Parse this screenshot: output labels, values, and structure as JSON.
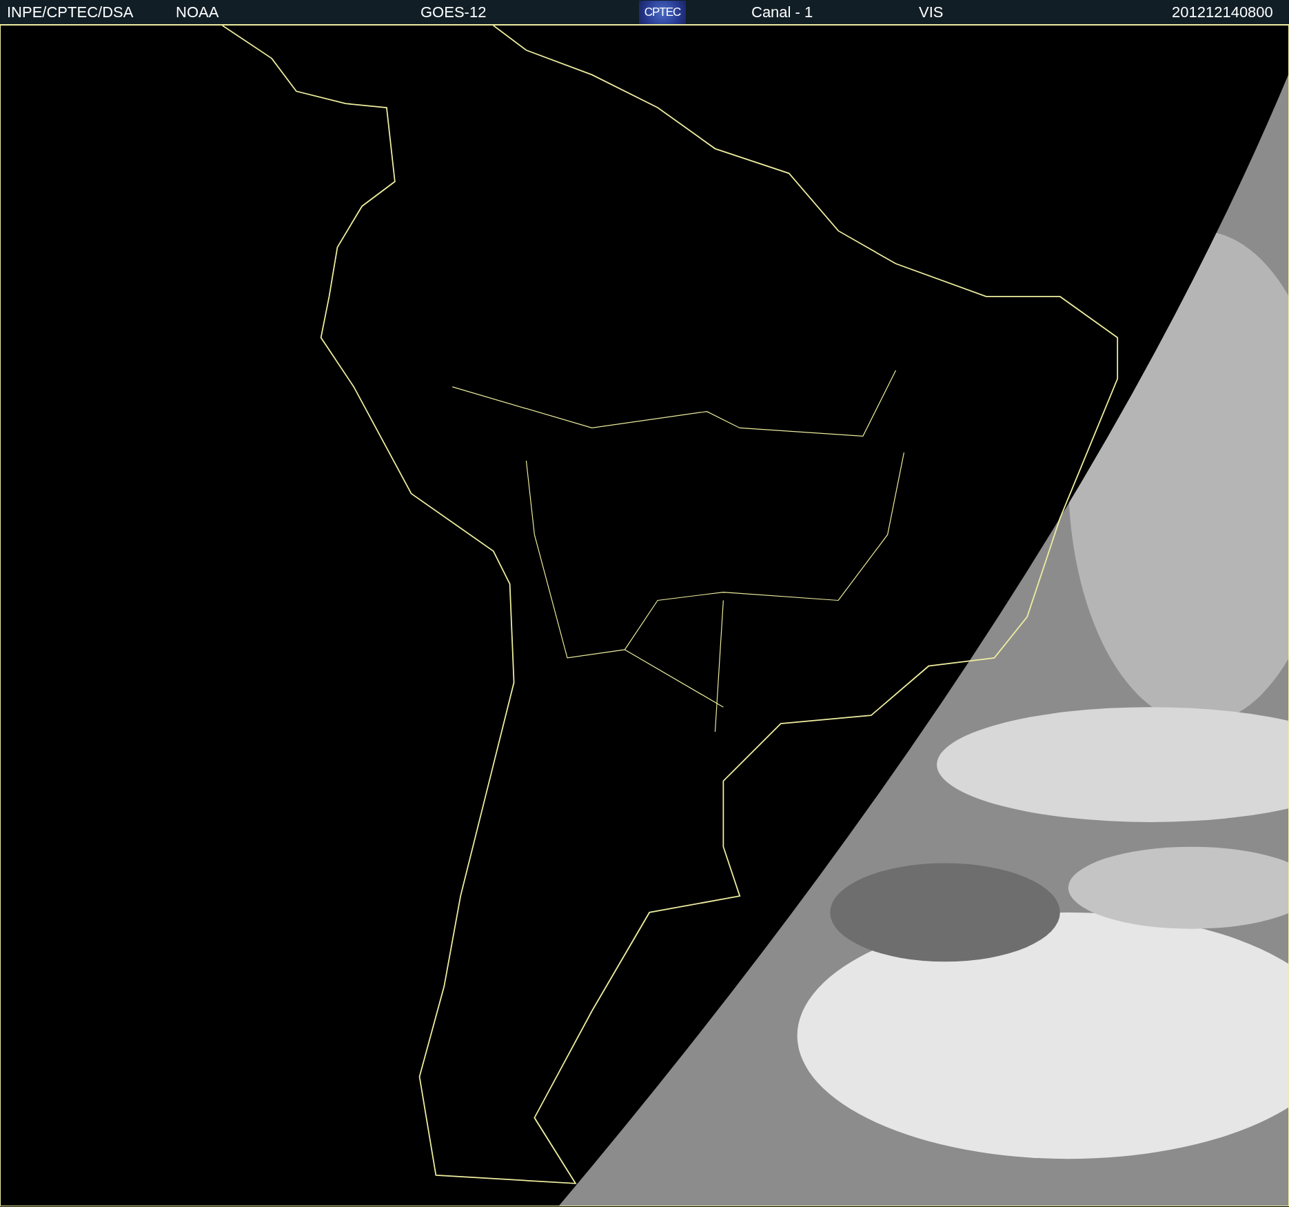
{
  "header": {
    "items": [
      {
        "kind": "text",
        "text": "INPE/CPTEC/DSA"
      },
      {
        "kind": "text",
        "text": "NOAA"
      },
      {
        "kind": "text",
        "text": "GOES-12"
      },
      {
        "kind": "logo",
        "text": "CPTEC"
      },
      {
        "kind": "text",
        "text": "Canal - 1"
      },
      {
        "kind": "text",
        "text": "VIS"
      },
      {
        "kind": "text",
        "text": "201212140800"
      }
    ]
  }
}
